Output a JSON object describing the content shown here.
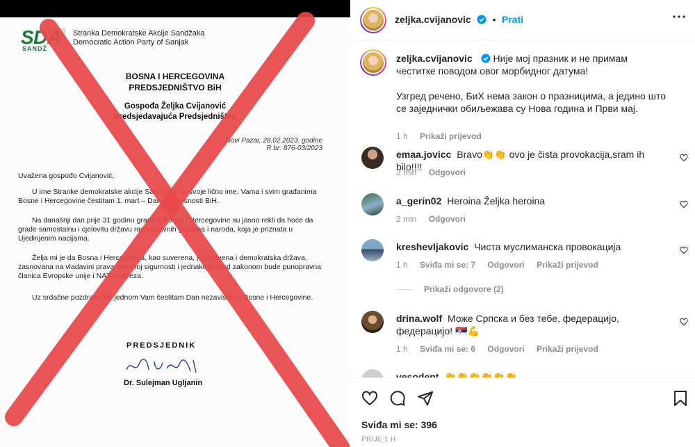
{
  "letter": {
    "logo_text": "SDA",
    "org_line1": "Stranka Demokratske Akcije Sandžaka",
    "org_line2": "Democratic Action Party of Sanjak",
    "header1": "BOSNA I HERCEGOVINA",
    "header2": "PREDSJEDNIŠTVO BiH",
    "addressee1": "Gospođa Željka Cvijanović",
    "addressee2": "predsjedavajuća Predsjedništva",
    "date_line1": "Novi Pazar, 28.02.2023. godine",
    "date_line2": "R.br: 876-03/2023",
    "greeting": "Uvažena gospođo Cvijanović,",
    "para1": "U ime Stranke demokratske akcije Sandžaka i u svoje lično ime, Vama i svim građanima Bosne i Hercegovine čestitam 1. mart – Dan nezavisnosti BiH.",
    "para2": "Na današnji dan prije 31 godinu građani Bosne i Hercegovine su jasno rekli da hoće da grade samostalnu i cjelovitu državu ravnopravnih građana i naroda, koja je priznata u Ujedinjenim nacijama.",
    "para3": "Želja mi je da Bosna i Hercegovina, kao suverena, jedinstvena i demokratska država, zasnovana na vladavini prava, pravnoj sigurnosti i jednakosti pred zakonom bude punopravna članica Evropske unije i NATO saveza.",
    "para4": "Uz srdačne pozdrave još jednom Vam čestitam Dan nezavisnosti Bosne i Hercegovine.",
    "sig_title": "PREDSJEDNIK",
    "sig_name": "Dr. Sulejman Ugljanin"
  },
  "post": {
    "username": "zeljka.cvijanovic",
    "follow_label": "Prati",
    "caption_user": "zeljka.cvijanovic",
    "caption_text": "Није мој празник и не примам честитке поводом овог морбидног датума!",
    "caption_text2": "Узгред речено, БиХ нема закон о празницима, а једино што се заједнички обиљежава су Нова година и Први мај.",
    "caption_time": "1 h",
    "caption_translate": "Prikaži prijevod"
  },
  "comments": [
    {
      "user": "emaa.jovicc",
      "text": "Bravo👏👏 ovo je čista provokacija,sram ih bilo!!!!",
      "time": "3 min",
      "likes": "",
      "reply": "Odgovori",
      "translate": ""
    },
    {
      "user": "a_gerin02",
      "text": "Heroina Željka heroina",
      "time": "2 min",
      "likes": "",
      "reply": "Odgovori",
      "translate": ""
    },
    {
      "user": "kreshevljakovic",
      "text": "Чиста муслиманска провокација",
      "time": "1 h",
      "likes": "Sviđa mi se: 7",
      "reply": "Odgovori",
      "translate": "Prikaži prijevod"
    },
    {
      "user": "drina.wolf",
      "text": "Може Српска и без тебе, федерацијо, федерацијо! 🇷🇸💪",
      "time": "1 h",
      "likes": "Sviđa mi se: 6",
      "reply": "Odgovori",
      "translate": "Prikaži prijevod"
    },
    {
      "user": "vesodent",
      "text": "👏👏👏👏👏👏",
      "time": "",
      "likes": "",
      "reply": "",
      "translate": ""
    }
  ],
  "view_replies": "Prikaži odgovore (2)",
  "footer": {
    "likes_label": "Sviđa mi se:",
    "likes_count": "396",
    "time_ago": "PRIJE 1 H"
  },
  "colors": {
    "accent_blue": "#0095f6",
    "red_x": "#e8484a",
    "muted": "#8e8e8e"
  },
  "icons": [
    "verified-icon",
    "more-options-icon",
    "heart-icon",
    "comment-icon",
    "share-icon",
    "bookmark-icon"
  ]
}
